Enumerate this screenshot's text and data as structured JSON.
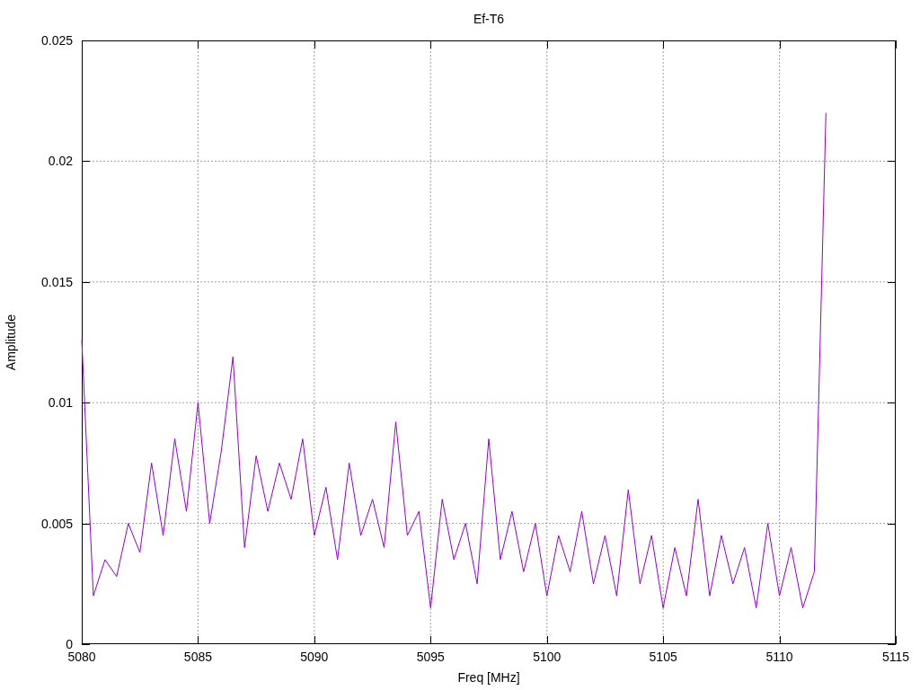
{
  "chart": {
    "chart_data": {
      "type": "line",
      "grid": true,
      "title": "Ef-T6",
      "xlabel": "Freq [MHz]",
      "ylabel": "Amplitude",
      "xlim": [
        5080,
        5115
      ],
      "ylim": [
        0,
        0.025
      ],
      "xticks": [
        5080,
        5085,
        5090,
        5095,
        5100,
        5105,
        5110,
        5115
      ],
      "yticks": [
        {
          "value": 0,
          "label": "0"
        },
        {
          "value": 0.005,
          "label": "0.005"
        },
        {
          "value": 0.01,
          "label": "0.01"
        },
        {
          "value": 0.015,
          "label": "0.015"
        },
        {
          "value": 0.02,
          "label": "0.02"
        },
        {
          "value": 0.025,
          "label": "0.025"
        }
      ],
      "x": [
        5080,
        5080.5,
        5081,
        5081.5,
        5082,
        5082.5,
        5083,
        5083.5,
        5084,
        5084.5,
        5085,
        5085.5,
        5086,
        5086.5,
        5087,
        5087.5,
        5088,
        5088.5,
        5089,
        5089.5,
        5090,
        5090.5,
        5091,
        5091.5,
        5092,
        5092.5,
        5093,
        5093.5,
        5094,
        5094.5,
        5095,
        5095.5,
        5096,
        5096.5,
        5097,
        5097.5,
        5098,
        5098.5,
        5099,
        5099.5,
        5100,
        5100.5,
        5101,
        5101.5,
        5102,
        5102.5,
        5103,
        5103.5,
        5104,
        5104.5,
        5105,
        5105.5,
        5106,
        5106.5,
        5107,
        5107.5,
        5108,
        5108.5,
        5109,
        5109.5,
        5110,
        5110.5,
        5111,
        5111.5,
        5112
      ],
      "series": [
        {
          "color": "#9400d3",
          "values": [
            0.0126,
            0.002,
            0.0035,
            0.0028,
            0.005,
            0.0038,
            0.0075,
            0.0045,
            0.0085,
            0.0055,
            0.01,
            0.005,
            0.008,
            0.0119,
            0.004,
            0.0078,
            0.0055,
            0.0075,
            0.006,
            0.0085,
            0.0045,
            0.0065,
            0.0035,
            0.0075,
            0.0045,
            0.006,
            0.004,
            0.0092,
            0.0045,
            0.0055,
            0.0015,
            0.006,
            0.0035,
            0.005,
            0.0025,
            0.0085,
            0.0035,
            0.0055,
            0.003,
            0.005,
            0.002,
            0.0045,
            0.003,
            0.0055,
            0.0025,
            0.0045,
            0.002,
            0.0064,
            0.0025,
            0.0045,
            0.0015,
            0.004,
            0.002,
            0.006,
            0.002,
            0.0045,
            0.0025,
            0.004,
            0.0015,
            0.005,
            0.002,
            0.004,
            0.0015,
            0.003,
            0.022
          ]
        }
      ]
    }
  }
}
